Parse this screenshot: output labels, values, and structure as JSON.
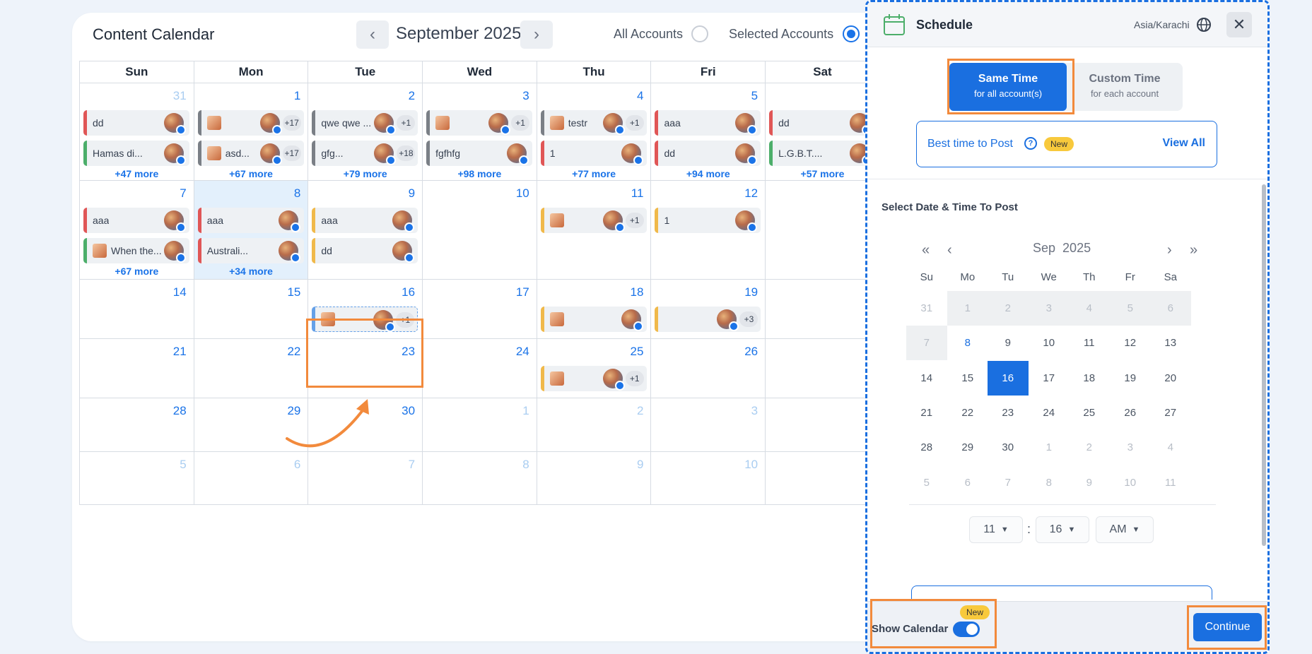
{
  "calendar": {
    "title": "Content Calendar",
    "month": "September 2025",
    "all_accounts": "All Accounts",
    "selected_accounts": "Selected Accounts",
    "weekdays": [
      "Sun",
      "Mon",
      "Tue",
      "Wed",
      "Thu",
      "Fri",
      "Sat"
    ],
    "weeks": [
      [
        {
          "day": "31",
          "muted": true,
          "events": [
            {
              "text": "dd",
              "color": "red"
            },
            {
              "text": "Hamas di...",
              "color": "green"
            }
          ],
          "more": "+47 more"
        },
        {
          "day": "1",
          "events": [
            {
              "text": "",
              "color": "gray",
              "thumb": true,
              "plus": "+17"
            },
            {
              "text": "asd...",
              "color": "gray",
              "thumb": true,
              "plus": "+17"
            }
          ],
          "more": "+67 more"
        },
        {
          "day": "2",
          "events": [
            {
              "text": "qwe qwe ...",
              "color": "gray",
              "plus": "+1"
            },
            {
              "text": "gfg...",
              "color": "gray",
              "plus": "+18"
            }
          ],
          "more": "+79 more"
        },
        {
          "day": "3",
          "events": [
            {
              "text": "",
              "color": "gray",
              "thumb": true,
              "plus": "+1"
            },
            {
              "text": "fgfhfg",
              "color": "gray"
            }
          ],
          "more": "+98 more"
        },
        {
          "day": "4",
          "events": [
            {
              "text": "testr",
              "color": "gray",
              "thumb": true,
              "plus": "+1"
            },
            {
              "text": "1",
              "color": "red"
            }
          ],
          "more": "+77 more"
        },
        {
          "day": "5",
          "events": [
            {
              "text": "aaa",
              "color": "red"
            },
            {
              "text": "dd",
              "color": "red"
            }
          ],
          "more": "+94 more"
        },
        {
          "day": "",
          "events": [
            {
              "text": "dd",
              "color": "red"
            },
            {
              "text": "L.G.B.T....",
              "color": "green"
            }
          ],
          "more": "+57 more"
        }
      ],
      [
        {
          "day": "7",
          "events": [
            {
              "text": "aaa",
              "color": "red"
            },
            {
              "text": "When the...",
              "color": "green",
              "thumb": true
            }
          ],
          "more": "+67 more"
        },
        {
          "day": "8",
          "today": true,
          "events": [
            {
              "text": "aaa",
              "color": "red"
            },
            {
              "text": "Australi...",
              "color": "red"
            }
          ],
          "more": "+34 more"
        },
        {
          "day": "9",
          "events": [
            {
              "text": "aaa",
              "color": "yellow"
            },
            {
              "text": "dd",
              "color": "yellow"
            }
          ],
          "more": ""
        },
        {
          "day": "10",
          "events": [],
          "more": ""
        },
        {
          "day": "11",
          "events": [
            {
              "text": "",
              "color": "yellow",
              "thumb": true,
              "plus": "+1"
            }
          ],
          "more": ""
        },
        {
          "day": "12",
          "events": [
            {
              "text": "1",
              "color": "yellow"
            }
          ],
          "more": ""
        },
        {
          "day": "",
          "events": [],
          "more": ""
        }
      ],
      [
        {
          "day": "14",
          "events": [],
          "more": ""
        },
        {
          "day": "15",
          "events": [],
          "more": ""
        },
        {
          "day": "16",
          "events": [
            {
              "text": "-",
              "color": "sel",
              "thumb": true,
              "plus": "+1"
            }
          ],
          "more": ""
        },
        {
          "day": "17",
          "events": [],
          "more": ""
        },
        {
          "day": "18",
          "events": [
            {
              "text": "",
              "color": "yellow",
              "thumb": true
            }
          ],
          "more": ""
        },
        {
          "day": "19",
          "events": [
            {
              "text": "",
              "color": "yellow",
              "plus": "+3"
            }
          ],
          "more": ""
        },
        {
          "day": "",
          "events": [],
          "more": ""
        }
      ],
      [
        {
          "day": "21",
          "events": [],
          "more": ""
        },
        {
          "day": "22",
          "events": [],
          "more": ""
        },
        {
          "day": "23",
          "events": [],
          "more": ""
        },
        {
          "day": "24",
          "events": [],
          "more": ""
        },
        {
          "day": "25",
          "events": [
            {
              "text": "",
              "color": "yellow",
              "thumb": true,
              "plus": "+1"
            }
          ],
          "more": ""
        },
        {
          "day": "26",
          "events": [],
          "more": ""
        },
        {
          "day": "",
          "events": [],
          "more": ""
        }
      ],
      [
        {
          "day": "28",
          "events": [],
          "more": ""
        },
        {
          "day": "29",
          "events": [],
          "more": ""
        },
        {
          "day": "30",
          "events": [],
          "more": ""
        },
        {
          "day": "1",
          "muted": true,
          "events": [],
          "more": ""
        },
        {
          "day": "2",
          "muted": true,
          "events": [],
          "more": ""
        },
        {
          "day": "3",
          "muted": true,
          "events": [],
          "more": ""
        },
        {
          "day": "",
          "events": [],
          "more": ""
        }
      ],
      [
        {
          "day": "5",
          "muted": true,
          "events": [],
          "more": ""
        },
        {
          "day": "6",
          "muted": true,
          "events": [],
          "more": ""
        },
        {
          "day": "7",
          "muted": true,
          "events": [],
          "more": ""
        },
        {
          "day": "8",
          "muted": true,
          "events": [],
          "more": ""
        },
        {
          "day": "9",
          "muted": true,
          "events": [],
          "more": ""
        },
        {
          "day": "10",
          "muted": true,
          "events": [],
          "more": ""
        },
        {
          "day": "",
          "events": [],
          "more": ""
        }
      ]
    ]
  },
  "schedule": {
    "title": "Schedule",
    "timezone": "Asia/Karachi",
    "same_time_title": "Same Time",
    "same_time_sub": "for all account(s)",
    "custom_time_title": "Custom Time",
    "custom_time_sub": "for each account",
    "best_time": "Best time to Post",
    "new_badge": "New",
    "view_all": "View All",
    "select_title": "Select Date & Time To Post",
    "dp_month": "Sep",
    "dp_year": "2025",
    "dp_weekdays": [
      "Su",
      "Mo",
      "Tu",
      "We",
      "Th",
      "Fr",
      "Sa"
    ],
    "dp_rows": [
      [
        "31",
        "1",
        "2",
        "3",
        "4",
        "5",
        "6"
      ],
      [
        "7",
        "8",
        "9",
        "10",
        "11",
        "12",
        "13"
      ],
      [
        "14",
        "15",
        "16",
        "17",
        "18",
        "19",
        "20"
      ],
      [
        "21",
        "22",
        "23",
        "24",
        "25",
        "26",
        "27"
      ],
      [
        "28",
        "29",
        "30",
        "1",
        "2",
        "3",
        "4"
      ],
      [
        "5",
        "6",
        "7",
        "8",
        "9",
        "10",
        "11"
      ]
    ],
    "selected_day": "16",
    "hour": "11",
    "minute": "16",
    "ampm": "AM",
    "show_calendar": "Show Calendar",
    "continue": "Continue"
  },
  "colors": {
    "primary": "#1a6fe0",
    "highlight": "#f28a3c",
    "new_badge": "#f8c93c"
  }
}
